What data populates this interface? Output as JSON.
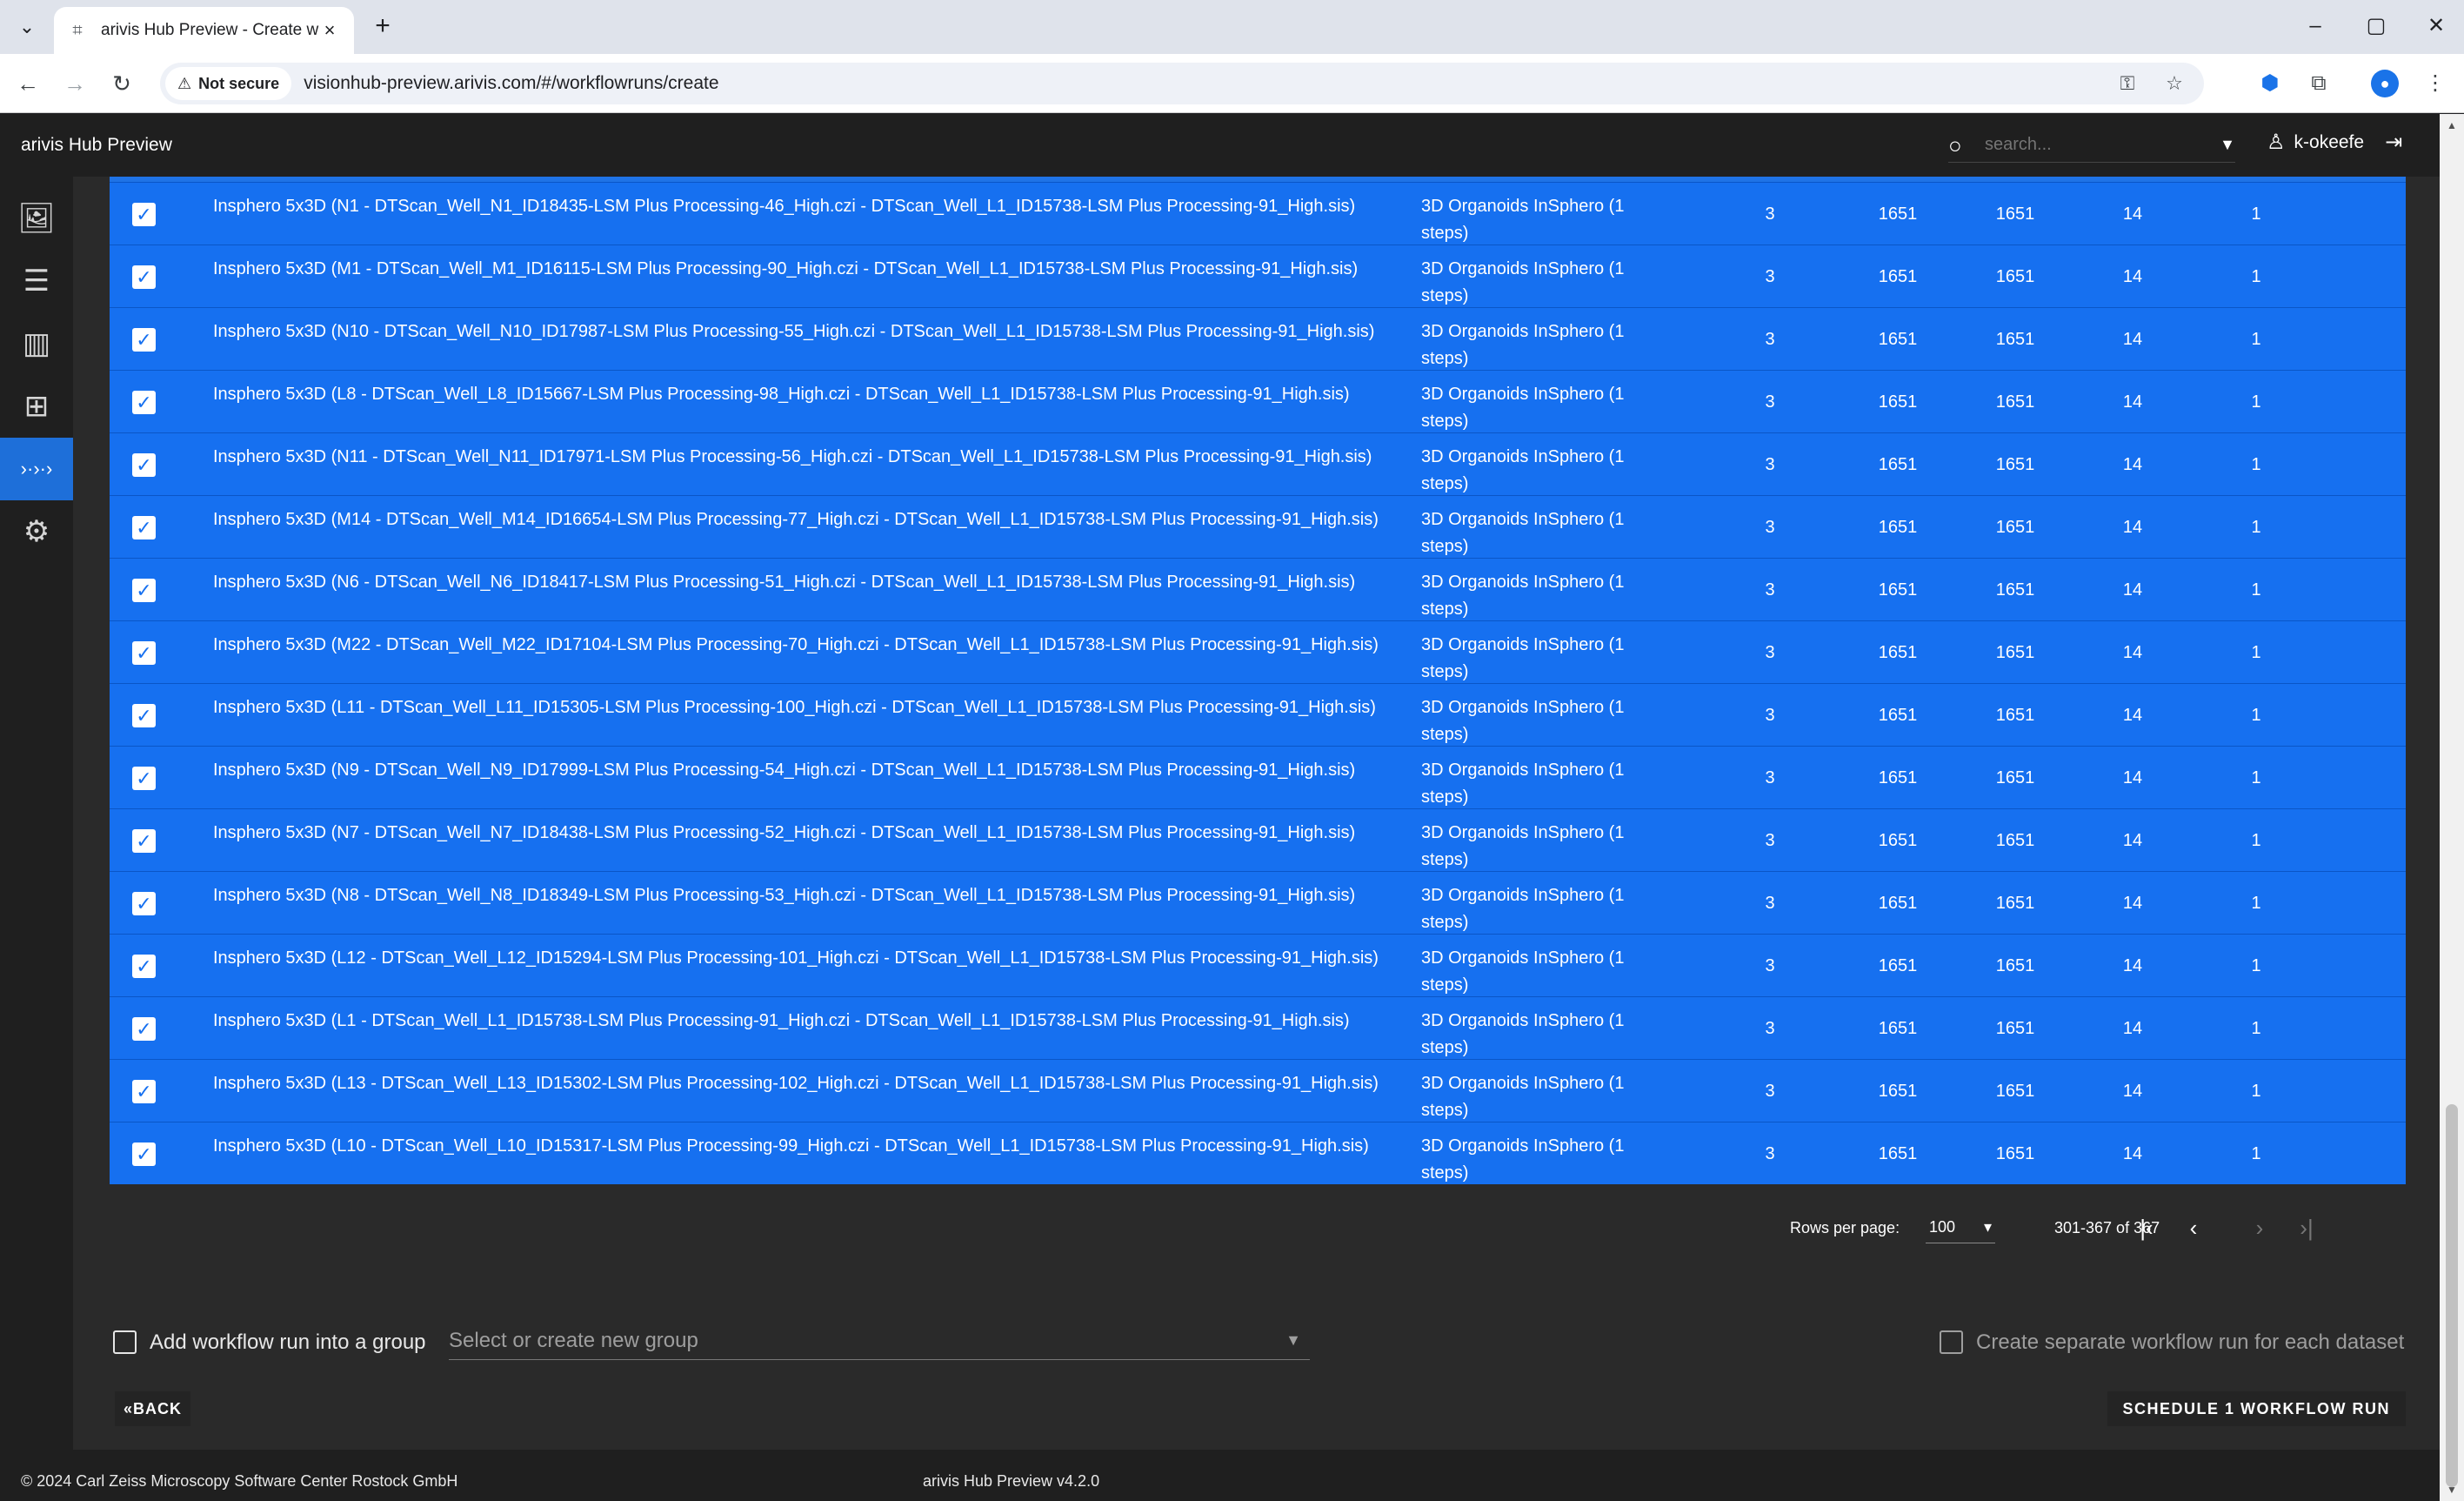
{
  "browser": {
    "tab_title": "arivis Hub Preview - Create wor",
    "tab_menu_icon": "chevron-down-icon",
    "new_tab_icon": "plus-icon",
    "security_label": "Not secure",
    "url": "visionhub-preview.arivis.com/#/workflowruns/create"
  },
  "app": {
    "title": "arivis Hub Preview",
    "search_placeholder": "search...",
    "username": "k-okeefe"
  },
  "sidebar": {
    "items": [
      {
        "icon": "images-icon",
        "active": false
      },
      {
        "icon": "sliders-icon",
        "active": false
      },
      {
        "icon": "bar-chart-icon",
        "active": false
      },
      {
        "icon": "workflow-icon",
        "active": false
      },
      {
        "icon": "workflow-runs-icon",
        "active": true
      },
      {
        "icon": "gear-icon",
        "active": false
      }
    ]
  },
  "table": {
    "rows": [
      {
        "checked": true,
        "name": "Insphero 5x3D (N1 - DTScan_Well_N1_ID18435-LSM Plus Processing-46_High.czi - DTScan_Well_L1_ID15738-LSM Plus Processing-91_High.sis)",
        "workflow": "3D Organoids InSphero (1 steps)",
        "c1": "3",
        "c2": "1651",
        "c3": "1651",
        "c4": "14",
        "c5": "1"
      },
      {
        "checked": true,
        "name": "Insphero 5x3D (M1 - DTScan_Well_M1_ID16115-LSM Plus Processing-90_High.czi - DTScan_Well_L1_ID15738-LSM Plus Processing-91_High.sis)",
        "workflow": "3D Organoids InSphero (1 steps)",
        "c1": "3",
        "c2": "1651",
        "c3": "1651",
        "c4": "14",
        "c5": "1"
      },
      {
        "checked": true,
        "name": "Insphero 5x3D (N10 - DTScan_Well_N10_ID17987-LSM Plus Processing-55_High.czi - DTScan_Well_L1_ID15738-LSM Plus Processing-91_High.sis)",
        "workflow": "3D Organoids InSphero (1 steps)",
        "c1": "3",
        "c2": "1651",
        "c3": "1651",
        "c4": "14",
        "c5": "1"
      },
      {
        "checked": true,
        "name": "Insphero 5x3D (L8 - DTScan_Well_L8_ID15667-LSM Plus Processing-98_High.czi - DTScan_Well_L1_ID15738-LSM Plus Processing-91_High.sis)",
        "workflow": "3D Organoids InSphero (1 steps)",
        "c1": "3",
        "c2": "1651",
        "c3": "1651",
        "c4": "14",
        "c5": "1"
      },
      {
        "checked": true,
        "name": "Insphero 5x3D (N11 - DTScan_Well_N11_ID17971-LSM Plus Processing-56_High.czi - DTScan_Well_L1_ID15738-LSM Plus Processing-91_High.sis)",
        "workflow": "3D Organoids InSphero (1 steps)",
        "c1": "3",
        "c2": "1651",
        "c3": "1651",
        "c4": "14",
        "c5": "1"
      },
      {
        "checked": true,
        "name": "Insphero 5x3D (M14 - DTScan_Well_M14_ID16654-LSM Plus Processing-77_High.czi - DTScan_Well_L1_ID15738-LSM Plus Processing-91_High.sis)",
        "workflow": "3D Organoids InSphero (1 steps)",
        "c1": "3",
        "c2": "1651",
        "c3": "1651",
        "c4": "14",
        "c5": "1"
      },
      {
        "checked": true,
        "name": "Insphero 5x3D (N6 - DTScan_Well_N6_ID18417-LSM Plus Processing-51_High.czi - DTScan_Well_L1_ID15738-LSM Plus Processing-91_High.sis)",
        "workflow": "3D Organoids InSphero (1 steps)",
        "c1": "3",
        "c2": "1651",
        "c3": "1651",
        "c4": "14",
        "c5": "1"
      },
      {
        "checked": true,
        "name": "Insphero 5x3D (M22 - DTScan_Well_M22_ID17104-LSM Plus Processing-70_High.czi - DTScan_Well_L1_ID15738-LSM Plus Processing-91_High.sis)",
        "workflow": "3D Organoids InSphero (1 steps)",
        "c1": "3",
        "c2": "1651",
        "c3": "1651",
        "c4": "14",
        "c5": "1"
      },
      {
        "checked": true,
        "name": "Insphero 5x3D (L11 - DTScan_Well_L11_ID15305-LSM Plus Processing-100_High.czi - DTScan_Well_L1_ID15738-LSM Plus Processing-91_High.sis)",
        "workflow": "3D Organoids InSphero (1 steps)",
        "c1": "3",
        "c2": "1651",
        "c3": "1651",
        "c4": "14",
        "c5": "1"
      },
      {
        "checked": true,
        "name": "Insphero 5x3D (N9 - DTScan_Well_N9_ID17999-LSM Plus Processing-54_High.czi - DTScan_Well_L1_ID15738-LSM Plus Processing-91_High.sis)",
        "workflow": "3D Organoids InSphero (1 steps)",
        "c1": "3",
        "c2": "1651",
        "c3": "1651",
        "c4": "14",
        "c5": "1"
      },
      {
        "checked": true,
        "name": "Insphero 5x3D (N7 - DTScan_Well_N7_ID18438-LSM Plus Processing-52_High.czi - DTScan_Well_L1_ID15738-LSM Plus Processing-91_High.sis)",
        "workflow": "3D Organoids InSphero (1 steps)",
        "c1": "3",
        "c2": "1651",
        "c3": "1651",
        "c4": "14",
        "c5": "1"
      },
      {
        "checked": true,
        "name": "Insphero 5x3D (N8 - DTScan_Well_N8_ID18349-LSM Plus Processing-53_High.czi - DTScan_Well_L1_ID15738-LSM Plus Processing-91_High.sis)",
        "workflow": "3D Organoids InSphero (1 steps)",
        "c1": "3",
        "c2": "1651",
        "c3": "1651",
        "c4": "14",
        "c5": "1"
      },
      {
        "checked": true,
        "name": "Insphero 5x3D (L12 - DTScan_Well_L12_ID15294-LSM Plus Processing-101_High.czi - DTScan_Well_L1_ID15738-LSM Plus Processing-91_High.sis)",
        "workflow": "3D Organoids InSphero (1 steps)",
        "c1": "3",
        "c2": "1651",
        "c3": "1651",
        "c4": "14",
        "c5": "1"
      },
      {
        "checked": true,
        "name": "Insphero 5x3D (L1 - DTScan_Well_L1_ID15738-LSM Plus Processing-91_High.czi - DTScan_Well_L1_ID15738-LSM Plus Processing-91_High.sis)",
        "workflow": "3D Organoids InSphero (1 steps)",
        "c1": "3",
        "c2": "1651",
        "c3": "1651",
        "c4": "14",
        "c5": "1"
      },
      {
        "checked": true,
        "name": "Insphero 5x3D (L13 - DTScan_Well_L13_ID15302-LSM Plus Processing-102_High.czi - DTScan_Well_L1_ID15738-LSM Plus Processing-91_High.sis)",
        "workflow": "3D Organoids InSphero (1 steps)",
        "c1": "3",
        "c2": "1651",
        "c3": "1651",
        "c4": "14",
        "c5": "1"
      },
      {
        "checked": true,
        "name": "Insphero 5x3D (L10 - DTScan_Well_L10_ID15317-LSM Plus Processing-99_High.czi - DTScan_Well_L1_ID15738-LSM Plus Processing-91_High.sis)",
        "workflow": "3D Organoids InSphero (1 steps)",
        "c1": "3",
        "c2": "1651",
        "c3": "1651",
        "c4": "14",
        "c5": "1"
      }
    ]
  },
  "pagination": {
    "rows_per_page_label": "Rows per page:",
    "rows_per_page_value": "100",
    "range": "301-367 of 367"
  },
  "group": {
    "add_label": "Add workflow run into a group",
    "select_placeholder": "Select or create new group",
    "separate_label": "Create separate workflow run for each dataset"
  },
  "actions": {
    "back_label": "BACK",
    "schedule_label": "SCHEDULE 1 WORKFLOW RUN"
  },
  "footer": {
    "copyright": "© 2024 Carl Zeiss Microscopy Software Center Rostock GmbH",
    "version": "arivis Hub Preview v4.2.0"
  },
  "colors": {
    "selected_row": "#1670f0",
    "active_sidebar": "#1e6fd9",
    "app_background": "#2a2a2a"
  }
}
